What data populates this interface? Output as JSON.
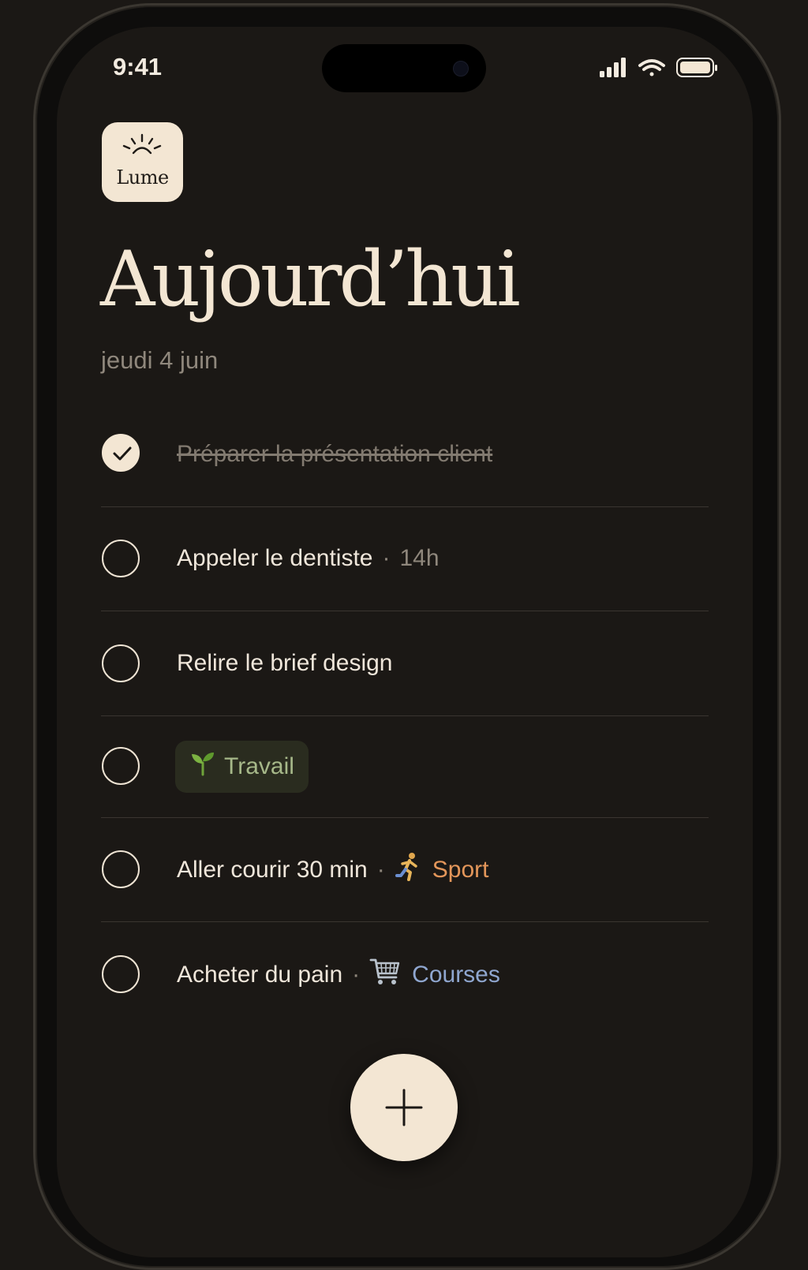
{
  "status_bar": {
    "time": "9:41"
  },
  "app": {
    "logo_text": "Lume"
  },
  "header": {
    "title": "Aujourd’hui",
    "date": "jeudi 4 juin"
  },
  "tasks": [
    {
      "title": "Préparer la présentation client",
      "done": true
    },
    {
      "title": "Appeler le dentiste",
      "time": "14h",
      "done": false
    },
    {
      "title": "Relire le brief design",
      "done": false
    },
    {
      "title": "",
      "tag": "Travail",
      "tag_icon": "seedling-icon",
      "done": false
    },
    {
      "title": "Aller courir 30 min",
      "tag": "Sport",
      "tag_icon": "runner-icon",
      "done": false
    },
    {
      "title": "Acheter du pain",
      "tag": "Courses",
      "tag_icon": "shopping-cart-icon",
      "done": false
    }
  ],
  "fab": {
    "icon": "plus-icon"
  },
  "colors": {
    "background": "#1b1815",
    "cream": "#f3e6d3",
    "muted_text": "#8f877c",
    "tag_travail": "#a6b889",
    "tag_sport": "#e3965a",
    "tag_courses": "#8fa6cf"
  }
}
